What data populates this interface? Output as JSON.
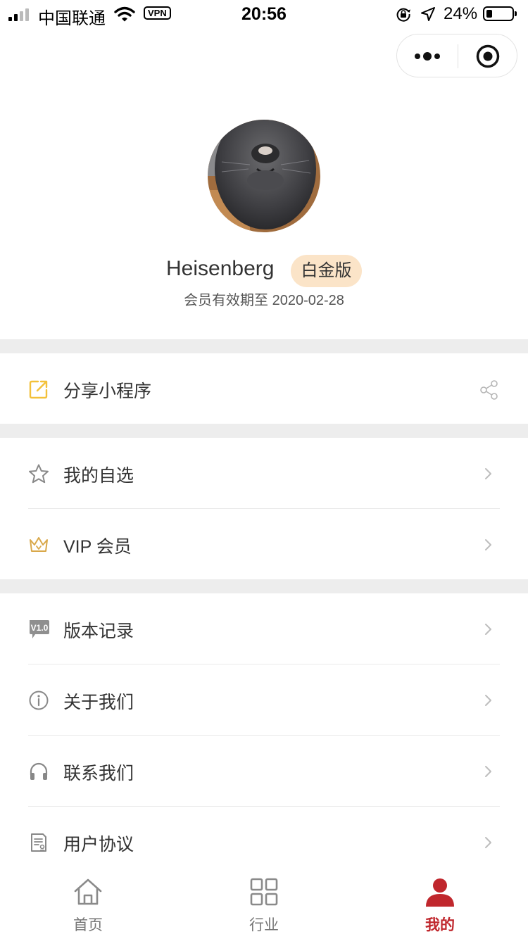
{
  "status_bar": {
    "carrier": "中国联通",
    "vpn": "VPN",
    "time": "20:56",
    "battery_percent": "24%",
    "battery_level": 0.24,
    "icons": [
      "signal-icon",
      "wifi-icon",
      "rotation-lock-icon",
      "location-arrow-icon",
      "battery-icon"
    ]
  },
  "capsule": {
    "icons": [
      "more-dots-icon",
      "close-target-icon"
    ]
  },
  "profile": {
    "username": "Heisenberg",
    "tier": "白金版",
    "expiry": "会员有效期至 2020-02-28"
  },
  "menu": {
    "share": {
      "label": "分享小程序",
      "icon": "share-external-icon",
      "trailing_icon": "share-icon"
    },
    "favorites": {
      "label": "我的自选",
      "icon": "star-icon"
    },
    "vip": {
      "label": "VIP 会员",
      "icon": "crown-icon"
    },
    "versions": {
      "label": "版本记录",
      "icon": "version-tag-icon",
      "icon_text": "V1.0"
    },
    "about": {
      "label": "关于我们",
      "icon": "info-icon"
    },
    "contact": {
      "label": "联系我们",
      "icon": "headphones-icon"
    },
    "agreement": {
      "label": "用户协议",
      "icon": "document-icon"
    }
  },
  "tabbar": {
    "tabs": [
      {
        "label": "首页",
        "icon": "home-icon",
        "active": false
      },
      {
        "label": "行业",
        "icon": "grid-icon",
        "active": false
      },
      {
        "label": "我的",
        "icon": "user-icon",
        "active": true
      }
    ]
  },
  "colors": {
    "accent_red": "#c0272d",
    "badge_bg": "#fbe4c8",
    "separator": "#ededed",
    "share_icon_yellow": "#f3c13a",
    "crown_gold": "#d9a84a"
  }
}
